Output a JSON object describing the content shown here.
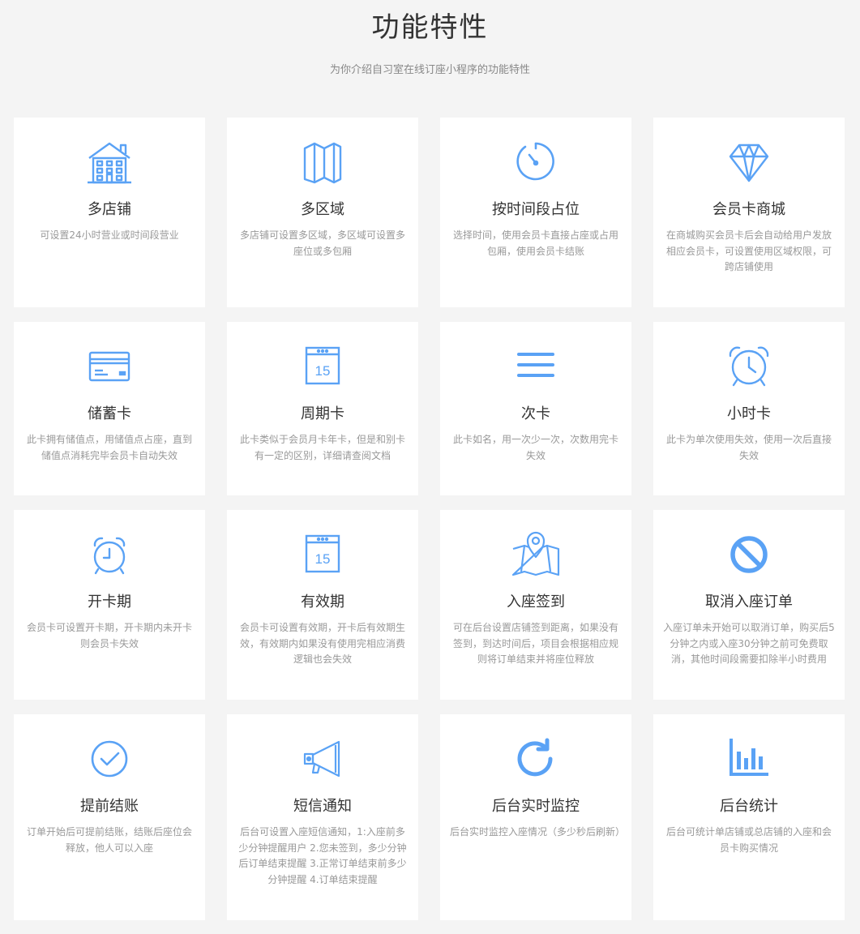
{
  "header": {
    "title": "功能特性",
    "subtitle": "为你介绍自习室在线订座小程序的功能特性"
  },
  "accent_color": "#5aa2f5",
  "features": [
    {
      "icon": "building-icon",
      "title": "多店铺",
      "desc": "可设置24小时营业或时间段营业"
    },
    {
      "icon": "map-icon",
      "title": "多区域",
      "desc": "多店铺可设置多区域，多区域可设置多座位或多包厢"
    },
    {
      "icon": "timer-icon",
      "title": "按时间段占位",
      "desc": "选择时间，使用会员卡直接占座或占用包厢，使用会员卡结账"
    },
    {
      "icon": "diamond-icon",
      "title": "会员卡商城",
      "desc": "在商城购买会员卡后会自动给用户发放相应会员卡，可设置使用区域权限，可跨店铺使用"
    },
    {
      "icon": "credit-card-icon",
      "title": "储蓄卡",
      "desc": "此卡拥有储值点，用储值点占座，直到储值点消耗完毕会员卡自动失效"
    },
    {
      "icon": "calendar-icon",
      "title": "周期卡",
      "desc": "此卡类似于会员月卡年卡，但是和别卡有一定的区别，详细请查阅文档",
      "day": "15"
    },
    {
      "icon": "menu-lines-icon",
      "title": "次卡",
      "desc": "此卡如名，用一次少一次，次数用完卡失效"
    },
    {
      "icon": "alarm-clock-icon",
      "title": "小时卡",
      "desc": "此卡为单次使用失效，使用一次后直接失效"
    },
    {
      "icon": "alarm-clock-icon",
      "title": "开卡期",
      "desc": "会员卡可设置开卡期，开卡期内未开卡则会员卡失效"
    },
    {
      "icon": "calendar-icon",
      "title": "有效期",
      "desc": "会员卡可设置有效期，开卡后有效期生效，有效期内如果没有使用完相应消费逻辑也会失效",
      "day": "15"
    },
    {
      "icon": "map-pin-icon",
      "title": "入座签到",
      "desc": "可在后台设置店铺签到距离，如果没有签到，到达时间后，项目会根据相应规则将订单结束并将座位释放"
    },
    {
      "icon": "prohibited-icon",
      "title": "取消入座订单",
      "desc": "入座订单未开始可以取消订单，购买后5分钟之内或入座30分钟之前可免费取消，其他时间段需要扣除半小时费用"
    },
    {
      "icon": "check-circle-icon",
      "title": "提前结账",
      "desc": "订单开始后可提前结账，结账后座位会释放，他人可以入座"
    },
    {
      "icon": "megaphone-icon",
      "title": "短信通知",
      "desc": "后台可设置入座短信通知，1:入座前多少分钟提醒用户 2.您未签到，多少分钟后订单结束提醒 3.正常订单结束前多少分钟提醒 4.订单结束提醒"
    },
    {
      "icon": "refresh-icon",
      "title": "后台实时监控",
      "desc": "后台实时监控入座情况（多少秒后刷新）"
    },
    {
      "icon": "bar-chart-icon",
      "title": "后台统计",
      "desc": "后台可统计单店铺或总店铺的入座和会员卡购买情况"
    }
  ]
}
